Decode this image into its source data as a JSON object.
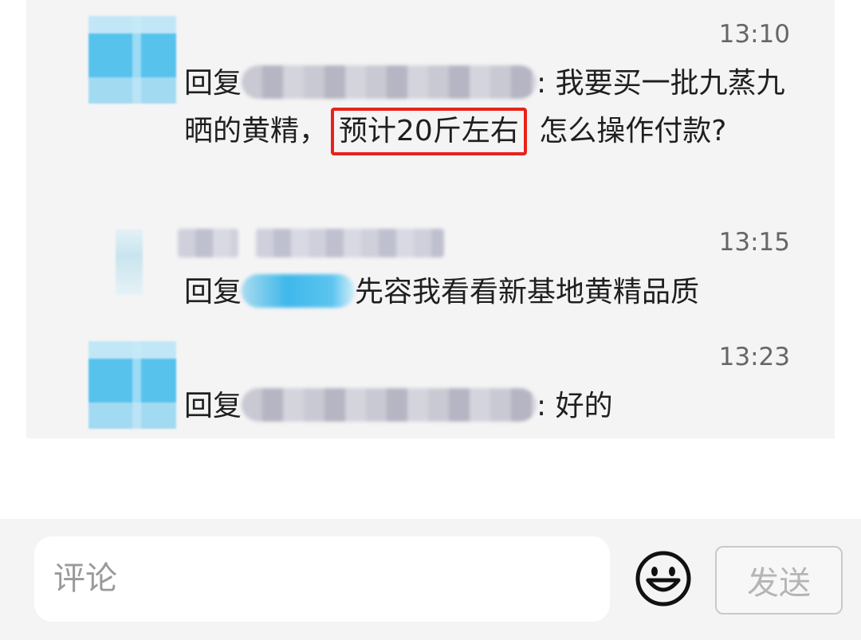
{
  "replies": [
    {
      "time": "13:10",
      "prefix": "回复",
      "sep": ":",
      "text_before": "我要买一批九蒸九晒的黄精，",
      "highlight": "预计20斤左右",
      "text_after": "怎么操作付款?"
    },
    {
      "time": "13:15",
      "prefix": "回复",
      "text": "先容我看看新基地黄精品质"
    },
    {
      "time": "13:23",
      "prefix": "回复",
      "sep": ":",
      "text": "好的"
    }
  ],
  "composer": {
    "placeholder": "评论",
    "send_label": "发送",
    "emoji_icon": "smiley-icon"
  },
  "colors": {
    "thread_bg": "#f4f4f5",
    "highlight_border": "#e8221b",
    "timestamp": "#666666"
  }
}
